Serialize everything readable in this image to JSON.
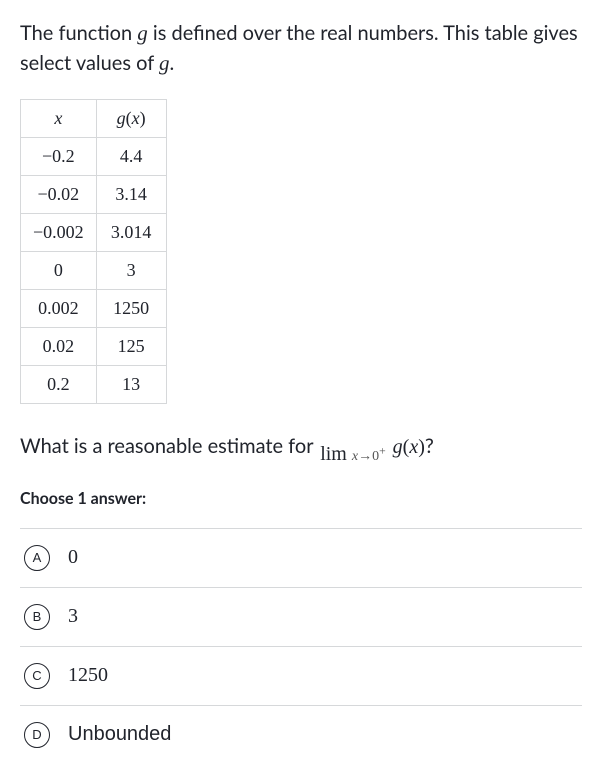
{
  "intro": {
    "part1": "The function ",
    "fn": "g",
    "part2": " is defined over the real numbers. This table gives select values of ",
    "fn2": "g",
    "part3": "."
  },
  "chart_data": {
    "type": "table",
    "columns": [
      "x",
      "g(x)"
    ],
    "rows": [
      {
        "x": "−0.2",
        "gx": "4.4"
      },
      {
        "x": "−0.02",
        "gx": "3.14"
      },
      {
        "x": "−0.002",
        "gx": "3.014"
      },
      {
        "x": "0",
        "gx": "3"
      },
      {
        "x": "0.002",
        "gx": "1250"
      },
      {
        "x": "0.02",
        "gx": "125"
      },
      {
        "x": "0.2",
        "gx": "13"
      }
    ]
  },
  "question": {
    "prefix": "What is a reasonable estimate for ",
    "lim_top": "lim",
    "lim_bot_var": "x",
    "lim_bot_arrow": "→",
    "lim_bot_target": "0",
    "lim_bot_sup": "+",
    "fn": "g",
    "paren_open": "(",
    "arg": "x",
    "paren_close": ")",
    "q_mark": "?"
  },
  "choose_label": "Choose 1 answer:",
  "choices": [
    {
      "letter": "A",
      "text": "0",
      "type": "math"
    },
    {
      "letter": "B",
      "text": "3",
      "type": "math"
    },
    {
      "letter": "C",
      "text": "1250",
      "type": "math"
    },
    {
      "letter": "D",
      "text": "Unbounded",
      "type": "sans"
    }
  ]
}
